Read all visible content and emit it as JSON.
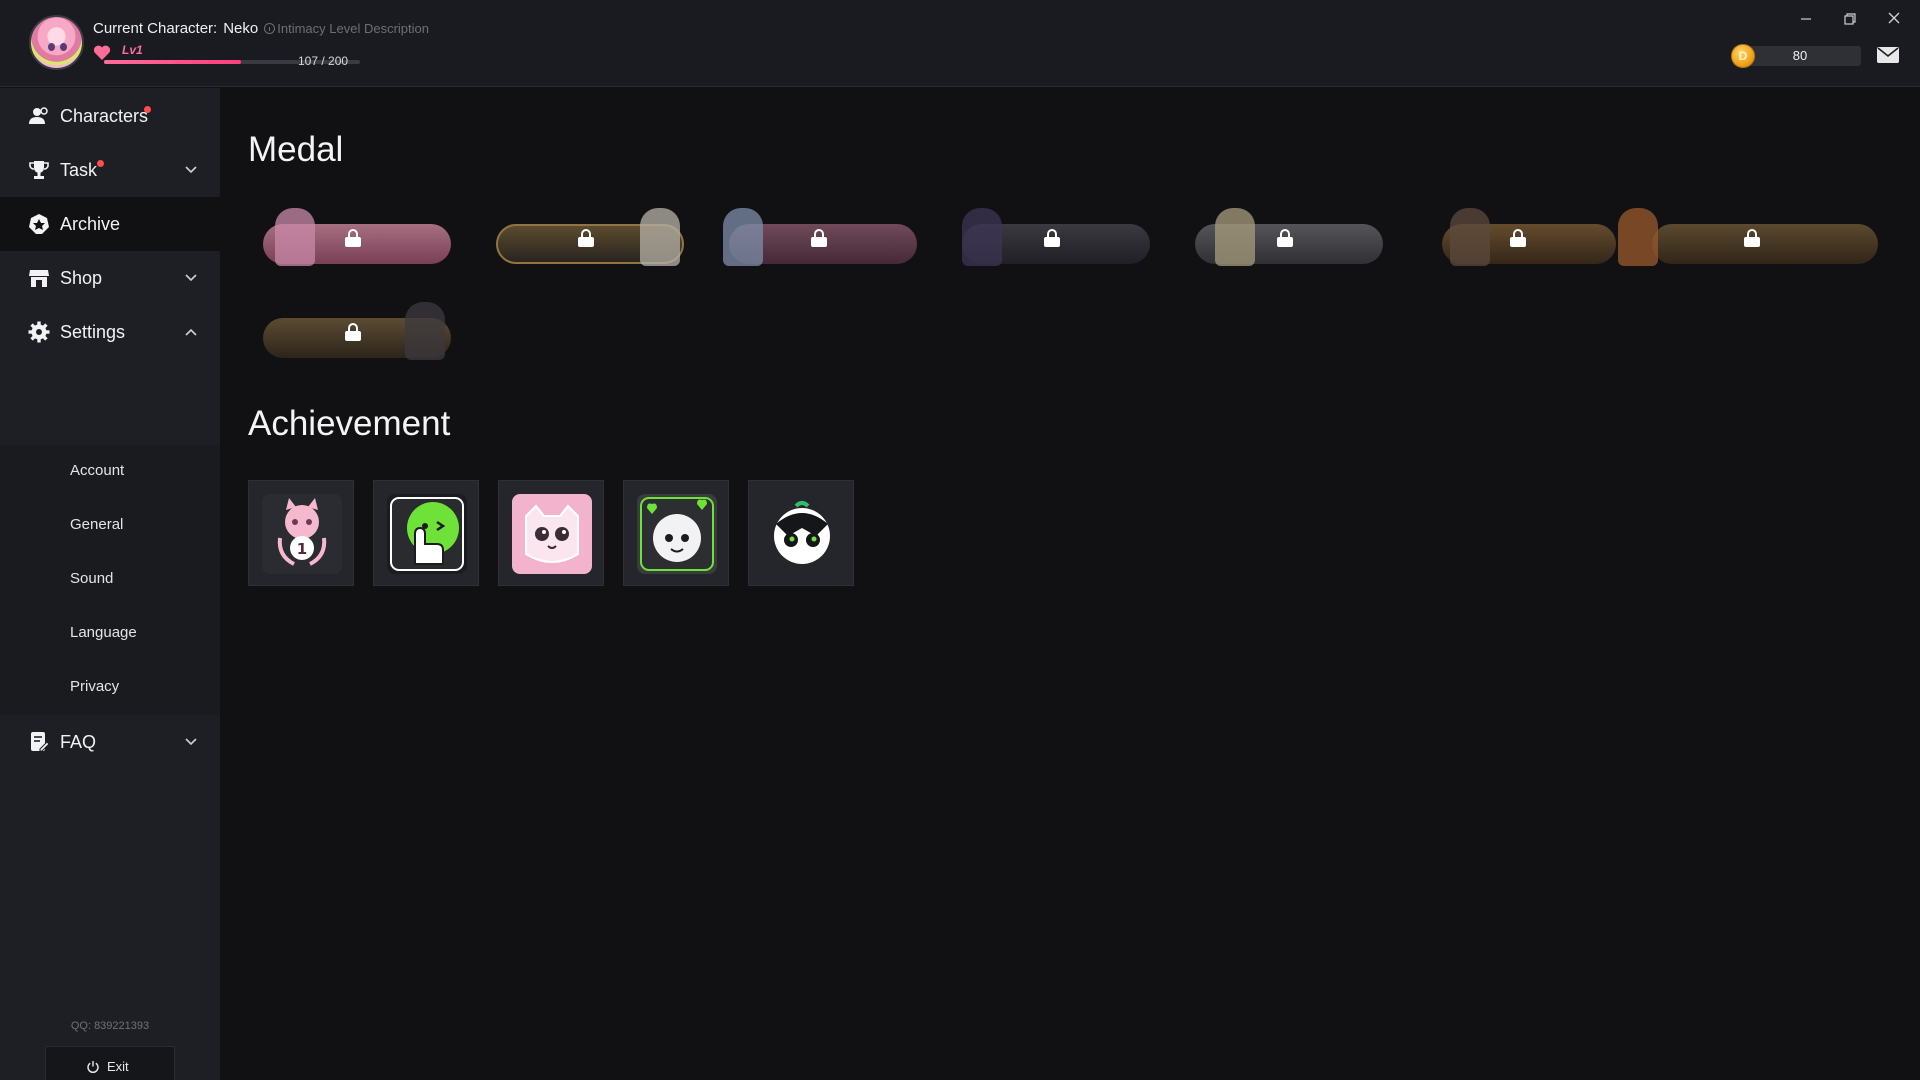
{
  "header": {
    "current_character_label": "Current Character:",
    "character_name": "Neko",
    "intimacy_desc": "Intimacy Level Description",
    "level_label": "Lv1",
    "level_progress_text": "107 / 200",
    "level_progress_value": 0.535,
    "coin_symbol": "D",
    "coins": "80"
  },
  "sidebar": {
    "items": [
      {
        "label": "Characters"
      },
      {
        "label": "Task"
      },
      {
        "label": "Archive"
      },
      {
        "label": "Shop"
      },
      {
        "label": "Settings"
      },
      {
        "label": "FAQ"
      }
    ],
    "settings_sub": [
      {
        "label": "Account"
      },
      {
        "label": "General"
      },
      {
        "label": "Sound"
      },
      {
        "label": "Language"
      },
      {
        "label": "Privacy"
      }
    ],
    "qq": "QQ: 839221393",
    "exit_label": "Exit"
  },
  "main": {
    "medal_title": "Medal",
    "achievement_title": "Achievement",
    "medal_count": 8,
    "medals_locked": true,
    "achievement_count": 5
  },
  "colors": {
    "accent_pink": "#ff6c9a",
    "notification_dot": "#ff4d4d",
    "coin": "#f2a31b",
    "achievement_green": "#6fe23a"
  }
}
